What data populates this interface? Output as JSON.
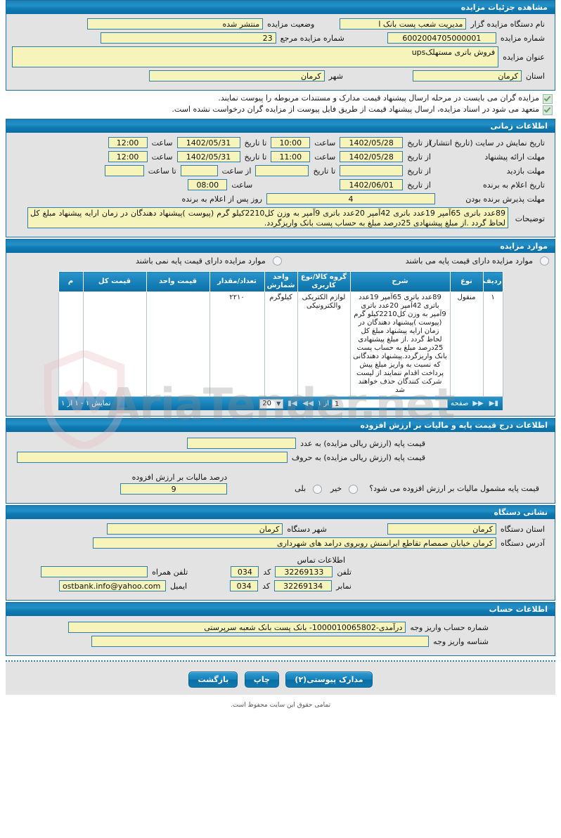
{
  "sections": {
    "details": "مشاهده جزئیات مزایده",
    "time": "اطلاعات زمانی",
    "items": "موارد مزایده",
    "price_vat": "اطلاعات درج قیمت پایه و مالیات بر ارزش افزوده",
    "org": "نشانی دستگاه",
    "account": "اطلاعات حساب"
  },
  "details": {
    "org_name_label": "نام دستگاه مزایده گزار",
    "org_name_value": "مدیریت شعب پست بانک ا",
    "status_label": "وضعیت مزایده",
    "status_value": "منتشر شده",
    "number_label": "شماره مزایده",
    "number_value": "6002004705000001",
    "ref_number_label": "شماره مزایده مرجع",
    "ref_number_value": "23",
    "title_label": "عنوان مزایده",
    "title_value": "فروش باتری مستهلکups",
    "province_label": "استان",
    "province_value": "کرمان",
    "city_label": "شهر",
    "city_value": "کرمان",
    "note1": "مزایده گران می بایست در مرحله ارسال پیشنهاد قیمت مدارک و مستندات مربوطه را پیوست نمایند.",
    "note2": "متعهد می شود در اسناد مزایده، ارسال پیشنهاد قیمت از طریق فایل پیوست از مزایده گران درخواست نشده است."
  },
  "time": {
    "publish_label": "تاریخ نمایش در سایت (تاریخ انتشار)",
    "publish_from_label": "از تاریخ",
    "publish_from": "1402/05/28",
    "publish_from_time_label": "ساعت",
    "publish_from_time": "10:00",
    "publish_to_label": "تا تاریخ",
    "publish_to": "1402/05/31",
    "publish_to_time_label": "ساعت",
    "publish_to_time": "12:00",
    "offer_label": "مهلت ارائه پیشنهاد",
    "offer_from_label": "از تاریخ",
    "offer_from": "1402/05/28",
    "offer_from_time_label": "ساعت",
    "offer_from_time": "11:00",
    "offer_to_label": "تا تاریخ",
    "offer_to": "1402/05/31",
    "offer_to_time_label": "ساعت",
    "offer_to_time": "12:00",
    "visit_label": "مهلت بازدید",
    "visit_from_label": "از تاریخ",
    "visit_from": "",
    "visit_to_label": "تا تاریخ",
    "visit_to": "",
    "visit_from_time_label": "از ساعت",
    "visit_from_time": "",
    "visit_to_time_label": "تا ساعت",
    "visit_to_time": "",
    "winner_label": "تاریخ اعلام به برنده",
    "winner_from_label": "از تاریخ",
    "winner_from": "1402/06/01",
    "winner_time_label": "ساعت",
    "winner_time": "08:00",
    "accept_label": "مهلت پذیرش برنده بودن",
    "accept_days": "4",
    "accept_suffix": "روز پس از اعلام به برنده",
    "desc_label": "توضیحات",
    "desc_value": "89عدد باتری 65آمپر 19عدد باتری 42آمپر 20عدد باتری 9آمپر به وزن کل2210کیلو گرم (پیوست )پیشنهاد دهندگان در زمان ارایه پیشنهاد مبلغ کل لحاظ گردد .از مبلغ پیشنهادی 25درصد مبلغ به حساب پست بانک واریزگردد."
  },
  "items": {
    "radio_with_base": "موارد مزایده دارای قیمت پایه می باشند",
    "radio_without_base": "موارد مزایده دارای قیمت پایه نمی باشند",
    "columns": [
      "ردیف",
      "نوع",
      "شرح",
      "گروه کالا/نوع کاربری",
      "واحد شمارش",
      "تعداد/مقدار",
      "قیمت واحد",
      "قیمت کل",
      "م"
    ],
    "rows": [
      {
        "row_no": "۱",
        "type": "منقول",
        "description": "89عدد باتری 65آمپر 19عدد باتری 42آمپر 20عدد باتری 9آمپر به وزن کل2210کیلو گرم (پیوست )پیشنهاد دهندگان در زمان ارایه پیشنهاد مبلغ کل لحاظ گردد .از مبلغ پیشنهادی 25درصد مبلغ به حساب پست بانک واریزگردد.پیشنهاد دهندگانی که نسبت به واریز مبلغ پیش پرداخت اقدام ننمایند از لیست شرکت کنندگان حذف خواهند شد",
        "group": "لوازم الکتریکی والکترونیکی",
        "unit": "کیلوگرم",
        "quantity": "۲۲۱۰",
        "unit_price": "",
        "total_price": ""
      }
    ],
    "pager": {
      "page_label": "صفحه",
      "page_value": "1",
      "of_label": "از ۱",
      "page_size": "20",
      "first_icon": "first-page-icon",
      "prev_icon": "prev-page-icon",
      "next_icon": "next-page-icon",
      "last_icon": "last-page-icon",
      "summary": "نمایش ۱ - ۱ از ۱"
    }
  },
  "price_vat": {
    "base_num_label": "قیمت پایه (ارزش ریالی مزایده) به عدد",
    "base_num_value": "",
    "base_text_label": "قیمت پایه (ارزش ریالی مزایده) به حروف",
    "base_text_value": "",
    "vat_question": "قیمت پایه مشمول مالیات بر ارزش افزوده می شود؟",
    "vat_yes": "بلی",
    "vat_no": "خیر",
    "vat_percent_label": "درصد مالیات بر ارزش افزوده",
    "vat_percent_value": "9"
  },
  "org": {
    "province_label": "استان دستگاه",
    "province_value": "کرمان",
    "city_label": "شهر دستگاه",
    "city_value": "کرمان",
    "address_label": "آدرس دستگاه",
    "address_value": "کرمان خیابان صمصام تقاطع ایرانمنش روبروی درامد های شهرداری",
    "contact_title": "اطلاعات تماس",
    "phone_label": "تلفن",
    "phone_value": "32269133",
    "phone_code_label": "کد",
    "phone_code": "034",
    "mobile_label": "تلفن همراه",
    "mobile_value": "",
    "fax_label": "نمابر",
    "fax_value": "32269134",
    "fax_code_label": "کد",
    "fax_code": "034",
    "email_label": "ایمیل",
    "email_value": "ostbank.info@yahoo.com"
  },
  "account": {
    "account_no_label": "شماره حساب واریز وجه",
    "account_no_value": "درآمدی-1000010065802- بانک پست بانک شعبه سرپرستی",
    "account_id_label": "شناسه واریز وجه",
    "account_id_value": ""
  },
  "footer": {
    "attachments": "مدارک پیوستی(۲)",
    "print": "چاپ",
    "back": "بازگشت",
    "copyright": "تمامی حقوق این سایت محفوظ است."
  },
  "watermark": {
    "text": "AriaTender.net"
  }
}
